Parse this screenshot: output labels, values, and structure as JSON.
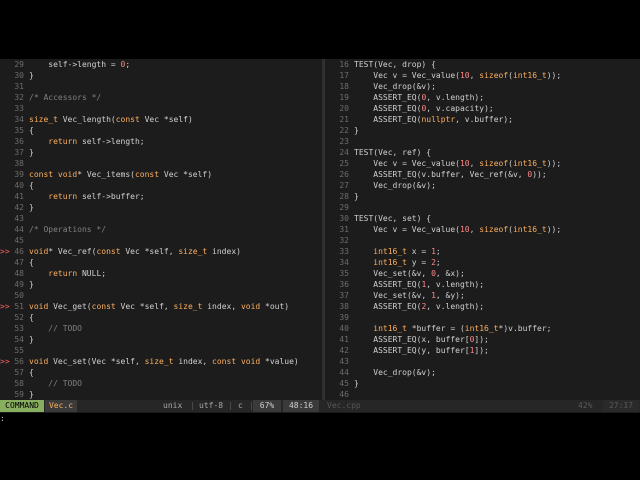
{
  "left_pane": {
    "lines": [
      {
        "n": "29",
        "sign": "",
        "code": "    self->length = 0;",
        "parts": [
          {
            "t": "    self->length = ",
            "c": ""
          },
          {
            "t": "0",
            "c": "num"
          },
          {
            "t": ";",
            "c": ""
          }
        ]
      },
      {
        "n": "30",
        "sign": "",
        "code": "}",
        "parts": [
          {
            "t": "}",
            "c": ""
          }
        ]
      },
      {
        "n": "31",
        "sign": "",
        "code": "",
        "parts": []
      },
      {
        "n": "32",
        "sign": "",
        "code": "/* Accessors */",
        "parts": [
          {
            "t": "/* Accessors */",
            "c": "cm"
          }
        ]
      },
      {
        "n": "33",
        "sign": "",
        "code": "",
        "parts": []
      },
      {
        "n": "34",
        "sign": "",
        "code": "size_t Vec_length(const Vec *self)",
        "parts": [
          {
            "t": "size_t",
            "c": "ty"
          },
          {
            "t": " Vec_length(",
            "c": ""
          },
          {
            "t": "const",
            "c": "kw"
          },
          {
            "t": " Vec *self)",
            "c": ""
          }
        ]
      },
      {
        "n": "35",
        "sign": "",
        "code": "{",
        "parts": [
          {
            "t": "{",
            "c": ""
          }
        ]
      },
      {
        "n": "36",
        "sign": "",
        "code": "    return self->length;",
        "parts": [
          {
            "t": "    ",
            "c": ""
          },
          {
            "t": "return",
            "c": "kw"
          },
          {
            "t": " self->length;",
            "c": ""
          }
        ]
      },
      {
        "n": "37",
        "sign": "",
        "code": "}",
        "parts": [
          {
            "t": "}",
            "c": ""
          }
        ]
      },
      {
        "n": "38",
        "sign": "",
        "code": "",
        "parts": []
      },
      {
        "n": "39",
        "sign": "",
        "code": "const void* Vec_items(const Vec *self)",
        "parts": [
          {
            "t": "const",
            "c": "kw"
          },
          {
            "t": " ",
            "c": ""
          },
          {
            "t": "void",
            "c": "ty"
          },
          {
            "t": "* Vec_items(",
            "c": ""
          },
          {
            "t": "const",
            "c": "kw"
          },
          {
            "t": " Vec *self)",
            "c": ""
          }
        ]
      },
      {
        "n": "40",
        "sign": "",
        "code": "{",
        "parts": [
          {
            "t": "{",
            "c": ""
          }
        ]
      },
      {
        "n": "41",
        "sign": "",
        "code": "    return self->buffer;",
        "parts": [
          {
            "t": "    ",
            "c": ""
          },
          {
            "t": "return",
            "c": "kw"
          },
          {
            "t": " self->buffer;",
            "c": ""
          }
        ]
      },
      {
        "n": "42",
        "sign": "",
        "code": "}",
        "parts": [
          {
            "t": "}",
            "c": ""
          }
        ]
      },
      {
        "n": "43",
        "sign": "",
        "code": "",
        "parts": []
      },
      {
        "n": "44",
        "sign": "",
        "code": "/* Operations */",
        "parts": [
          {
            "t": "/* Operations */",
            "c": "cm"
          }
        ]
      },
      {
        "n": "45",
        "sign": "",
        "code": "",
        "parts": []
      },
      {
        "n": "46",
        "sign": ">>",
        "code": "void* Vec_ref(const Vec *self, size_t index)",
        "parts": [
          {
            "t": "void",
            "c": "ty"
          },
          {
            "t": "* Vec_ref(",
            "c": ""
          },
          {
            "t": "const",
            "c": "kw"
          },
          {
            "t": " Vec *self, ",
            "c": ""
          },
          {
            "t": "size_t",
            "c": "ty"
          },
          {
            "t": " index)",
            "c": ""
          }
        ]
      },
      {
        "n": "47",
        "sign": "",
        "code": "{",
        "parts": [
          {
            "t": "{",
            "c": ""
          }
        ]
      },
      {
        "n": "48",
        "sign": "",
        "code": "    return NULL;",
        "parts": [
          {
            "t": "    ",
            "c": ""
          },
          {
            "t": "return",
            "c": "kw"
          },
          {
            "t": " NULL;",
            "c": ""
          }
        ]
      },
      {
        "n": "49",
        "sign": "",
        "code": "}",
        "parts": [
          {
            "t": "}",
            "c": ""
          }
        ]
      },
      {
        "n": "50",
        "sign": "",
        "code": "",
        "parts": []
      },
      {
        "n": "51",
        "sign": ">>",
        "code": "void Vec_get(const Vec *self, size_t index, void *out)",
        "parts": [
          {
            "t": "void",
            "c": "ty"
          },
          {
            "t": " Vec_get(",
            "c": ""
          },
          {
            "t": "const",
            "c": "kw"
          },
          {
            "t": " Vec *self, ",
            "c": ""
          },
          {
            "t": "size_t",
            "c": "ty"
          },
          {
            "t": " index, ",
            "c": ""
          },
          {
            "t": "void",
            "c": "ty"
          },
          {
            "t": " *out)",
            "c": ""
          }
        ]
      },
      {
        "n": "52",
        "sign": "",
        "code": "{",
        "parts": [
          {
            "t": "{",
            "c": ""
          }
        ]
      },
      {
        "n": "53",
        "sign": "",
        "code": "    // TODO",
        "parts": [
          {
            "t": "    // TODO",
            "c": "cm"
          }
        ]
      },
      {
        "n": "54",
        "sign": "",
        "code": "}",
        "parts": [
          {
            "t": "}",
            "c": ""
          }
        ]
      },
      {
        "n": "55",
        "sign": "",
        "code": "",
        "parts": []
      },
      {
        "n": "56",
        "sign": ">>",
        "code": "void Vec_set(Vec *self, size_t index, const void *value)",
        "parts": [
          {
            "t": "void",
            "c": "ty"
          },
          {
            "t": " Vec_set(Vec *self, ",
            "c": ""
          },
          {
            "t": "size_t",
            "c": "ty"
          },
          {
            "t": " index, ",
            "c": ""
          },
          {
            "t": "const",
            "c": "kw"
          },
          {
            "t": " ",
            "c": ""
          },
          {
            "t": "void",
            "c": "ty"
          },
          {
            "t": " *value)",
            "c": ""
          }
        ]
      },
      {
        "n": "57",
        "sign": "",
        "code": "{",
        "parts": [
          {
            "t": "{",
            "c": ""
          }
        ]
      },
      {
        "n": "58",
        "sign": "",
        "code": "    // TODO",
        "parts": [
          {
            "t": "    // TODO",
            "c": "cm"
          }
        ]
      },
      {
        "n": "59",
        "sign": "",
        "code": "}",
        "parts": [
          {
            "t": "}",
            "c": ""
          }
        ]
      }
    ]
  },
  "right_pane": {
    "lines": [
      {
        "n": "16",
        "sign": "",
        "parts": [
          {
            "t": "TEST(Vec, drop) {",
            "c": ""
          }
        ]
      },
      {
        "n": "17",
        "sign": "",
        "parts": [
          {
            "t": "    Vec v = Vec_value(",
            "c": ""
          },
          {
            "t": "10",
            "c": "num"
          },
          {
            "t": ", ",
            "c": ""
          },
          {
            "t": "sizeof",
            "c": "kw"
          },
          {
            "t": "(",
            "c": ""
          },
          {
            "t": "int16_t",
            "c": "ty"
          },
          {
            "t": "));",
            "c": ""
          }
        ]
      },
      {
        "n": "18",
        "sign": "",
        "parts": [
          {
            "t": "    Vec_drop(&v);",
            "c": ""
          }
        ]
      },
      {
        "n": "19",
        "sign": "",
        "parts": [
          {
            "t": "    ASSERT_EQ(",
            "c": ""
          },
          {
            "t": "0",
            "c": "num"
          },
          {
            "t": ", v.length);",
            "c": ""
          }
        ]
      },
      {
        "n": "20",
        "sign": "",
        "parts": [
          {
            "t": "    ASSERT_EQ(",
            "c": ""
          },
          {
            "t": "0",
            "c": "num"
          },
          {
            "t": ", v.capacity);",
            "c": ""
          }
        ]
      },
      {
        "n": "21",
        "sign": "",
        "parts": [
          {
            "t": "    ASSERT_EQ(",
            "c": ""
          },
          {
            "t": "nullptr",
            "c": "kw"
          },
          {
            "t": ", v.buffer);",
            "c": ""
          }
        ]
      },
      {
        "n": "22",
        "sign": "",
        "parts": [
          {
            "t": "}",
            "c": ""
          }
        ]
      },
      {
        "n": "23",
        "sign": "",
        "parts": []
      },
      {
        "n": "24",
        "sign": "",
        "parts": [
          {
            "t": "TEST(Vec, ref) {",
            "c": ""
          }
        ]
      },
      {
        "n": "25",
        "sign": "",
        "parts": [
          {
            "t": "    Vec v = Vec_value(",
            "c": ""
          },
          {
            "t": "10",
            "c": "num"
          },
          {
            "t": ", ",
            "c": ""
          },
          {
            "t": "sizeof",
            "c": "kw"
          },
          {
            "t": "(",
            "c": ""
          },
          {
            "t": "int16_t",
            "c": "ty"
          },
          {
            "t": "));",
            "c": ""
          }
        ]
      },
      {
        "n": "26",
        "sign": "",
        "parts": [
          {
            "t": "    ASSERT_EQ(v.buffer, Vec_ref(&v, ",
            "c": ""
          },
          {
            "t": "0",
            "c": "num"
          },
          {
            "t": "));",
            "c": ""
          }
        ]
      },
      {
        "n": "27",
        "sign": "",
        "parts": [
          {
            "t": "    Vec_drop(&v);",
            "c": ""
          }
        ]
      },
      {
        "n": "28",
        "sign": "",
        "parts": [
          {
            "t": "}",
            "c": ""
          }
        ]
      },
      {
        "n": "29",
        "sign": "",
        "parts": []
      },
      {
        "n": "30",
        "sign": "",
        "parts": [
          {
            "t": "TEST(Vec, set) {",
            "c": ""
          }
        ]
      },
      {
        "n": "31",
        "sign": "",
        "parts": [
          {
            "t": "    Vec v = Vec_value(",
            "c": ""
          },
          {
            "t": "10",
            "c": "num"
          },
          {
            "t": ", ",
            "c": ""
          },
          {
            "t": "sizeof",
            "c": "kw"
          },
          {
            "t": "(",
            "c": ""
          },
          {
            "t": "int16_t",
            "c": "ty"
          },
          {
            "t": "));",
            "c": ""
          }
        ]
      },
      {
        "n": "32",
        "sign": "",
        "parts": []
      },
      {
        "n": "33",
        "sign": "",
        "parts": [
          {
            "t": "    ",
            "c": ""
          },
          {
            "t": "int16_t",
            "c": "ty"
          },
          {
            "t": " x = ",
            "c": ""
          },
          {
            "t": "1",
            "c": "num"
          },
          {
            "t": ";",
            "c": ""
          }
        ]
      },
      {
        "n": "34",
        "sign": "",
        "parts": [
          {
            "t": "    ",
            "c": ""
          },
          {
            "t": "int16_t",
            "c": "ty"
          },
          {
            "t": " y = ",
            "c": ""
          },
          {
            "t": "2",
            "c": "num"
          },
          {
            "t": ";",
            "c": ""
          }
        ]
      },
      {
        "n": "35",
        "sign": "",
        "parts": [
          {
            "t": "    Vec_set(&v, ",
            "c": ""
          },
          {
            "t": "0",
            "c": "num"
          },
          {
            "t": ", &x);",
            "c": ""
          }
        ]
      },
      {
        "n": "36",
        "sign": "",
        "parts": [
          {
            "t": "    ASSERT_EQ(",
            "c": ""
          },
          {
            "t": "1",
            "c": "num"
          },
          {
            "t": ", v.length);",
            "c": ""
          }
        ]
      },
      {
        "n": "37",
        "sign": "",
        "parts": [
          {
            "t": "    Vec_set(&v, ",
            "c": ""
          },
          {
            "t": "1",
            "c": "num"
          },
          {
            "t": ", &y);",
            "c": ""
          }
        ]
      },
      {
        "n": "38",
        "sign": "",
        "parts": [
          {
            "t": "    ASSERT_EQ(",
            "c": ""
          },
          {
            "t": "2",
            "c": "num"
          },
          {
            "t": ", v.length);",
            "c": ""
          }
        ]
      },
      {
        "n": "39",
        "sign": "",
        "parts": []
      },
      {
        "n": "40",
        "sign": "",
        "parts": [
          {
            "t": "    ",
            "c": ""
          },
          {
            "t": "int16_t",
            "c": "ty"
          },
          {
            "t": " *buffer = (",
            "c": ""
          },
          {
            "t": "int16_t",
            "c": "ty"
          },
          {
            "t": "*)v.buffer;",
            "c": ""
          }
        ]
      },
      {
        "n": "41",
        "sign": "",
        "parts": [
          {
            "t": "    ASSERT_EQ(x, buffer[",
            "c": ""
          },
          {
            "t": "0",
            "c": "num"
          },
          {
            "t": "]);",
            "c": ""
          }
        ]
      },
      {
        "n": "42",
        "sign": "",
        "parts": [
          {
            "t": "    ASSERT_EQ(y, buffer[",
            "c": ""
          },
          {
            "t": "1",
            "c": "num"
          },
          {
            "t": "]);",
            "c": ""
          }
        ]
      },
      {
        "n": "43",
        "sign": "",
        "parts": []
      },
      {
        "n": "44",
        "sign": "",
        "parts": [
          {
            "t": "    Vec_drop(&v);",
            "c": ""
          }
        ]
      },
      {
        "n": "45",
        "sign": "",
        "parts": [
          {
            "t": "}",
            "c": ""
          }
        ]
      },
      {
        "n": "46",
        "sign": "",
        "parts": []
      }
    ]
  },
  "statusline": {
    "mode": "COMMAND",
    "left_filename": "Vec.c",
    "fileformat": "unix",
    "sep": "|",
    "encoding": "utf-8",
    "filetype": "c",
    "left_percent": "67%",
    "left_position": "48:16",
    "right_filename": "Vec.cpp",
    "right_percent": "42%",
    "right_position": "27:17"
  },
  "cmdline": {
    "text": ":"
  },
  "colors": {
    "background": "#1c1c1c",
    "mode_bg": "#87af5f",
    "keyword": "#ffaf5f",
    "number": "#ff8787",
    "comment": "#808080",
    "sign": "#ff5f5f"
  }
}
